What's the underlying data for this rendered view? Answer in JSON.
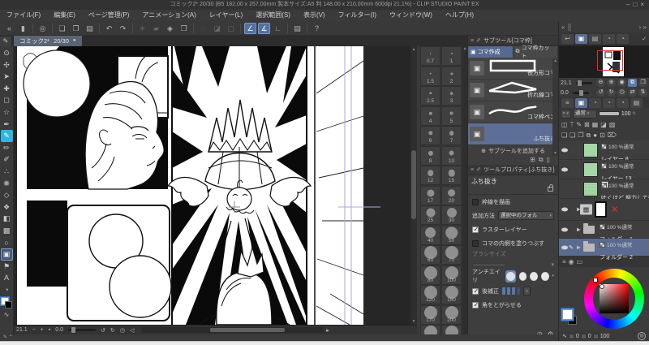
{
  "colors": {
    "accent_blue": "#5a7bb0",
    "tool_cyan": "#31b5e0",
    "selection_blue": "#5d6f96",
    "layer_green": "#a5d6a5",
    "navigator_red": "#e03030"
  },
  "title_bar": {
    "title": "コミック2* 20/30 (B5 182.00 x 257.00mm 製本サイズ:A5 判 148.00 x 210.00mm 600dpi 21.1%)  - CLIP STUDIO PAINT EX",
    "minimize": "–",
    "maximize": "□",
    "close": "×"
  },
  "menu": {
    "items": [
      "ファイル(F)",
      "編集(E)",
      "ページ管理(P)",
      "アニメーション(A)",
      "レイヤー(L)",
      "選択範囲(S)",
      "表示(V)",
      "フィルター(I)",
      "ウィンドウ(W)",
      "ヘルプ(H)"
    ]
  },
  "toolbar": {
    "buttons": [
      {
        "name": "collapse-toolbar",
        "glyph": "«",
        "state": "plain"
      },
      {
        "name": "handle",
        "glyph": "▮",
        "state": "plain"
      },
      {
        "name": "clip-studio-logo",
        "glyph": "◎",
        "state": "plain"
      },
      {
        "name": "new-file",
        "glyph": "❏",
        "state": "plain"
      },
      {
        "name": "open-file",
        "glyph": "❐",
        "state": "plain"
      },
      {
        "name": "save-file",
        "glyph": "▤",
        "state": "plain"
      },
      {
        "name": "undo",
        "glyph": "↶",
        "state": "plain"
      },
      {
        "name": "redo",
        "glyph": "↷",
        "state": "plain"
      },
      {
        "name": "clear",
        "glyph": "✳",
        "state": "dim"
      },
      {
        "name": "fill",
        "glyph": "▰",
        "state": "dim"
      },
      {
        "name": "gradient",
        "glyph": "◈",
        "state": "plain"
      },
      {
        "name": "crop",
        "glyph": "❒",
        "state": "plain"
      },
      {
        "name": "deselect",
        "glyph": "◌",
        "state": "dim"
      },
      {
        "name": "invert-selection",
        "glyph": "◪",
        "state": "dim"
      },
      {
        "name": "selection-border",
        "glyph": "▢",
        "state": "dim"
      },
      {
        "name": "snap-to-ruler",
        "glyph": "∠",
        "state": "active"
      },
      {
        "name": "snap-to-special-ruler",
        "glyph": "∡",
        "state": "active"
      },
      {
        "name": "snap-to-grid",
        "glyph": "∟",
        "state": "plain"
      },
      {
        "name": "page-manager",
        "glyph": "▤",
        "state": "plain"
      },
      {
        "name": "help",
        "glyph": "?",
        "state": "plain"
      }
    ]
  },
  "doc_tab": {
    "label": "コミック2*",
    "pages": "20/30",
    "modified_dot": "●",
    "pen_icon": "✎"
  },
  "tool_strip": {
    "tools": [
      {
        "name": "zoom-tool",
        "glyph": "⊙",
        "sel": ""
      },
      {
        "name": "hand-tool",
        "glyph": "✣",
        "sel": ""
      },
      {
        "name": "operate-tool",
        "glyph": "➤",
        "sel": ""
      },
      {
        "name": "move-layer-tool",
        "glyph": "✚",
        "sel": ""
      },
      {
        "name": "selection-tool",
        "glyph": "◻",
        "sel": ""
      },
      {
        "name": "auto-select-tool",
        "glyph": "☆",
        "sel": ""
      },
      {
        "name": "eyedropper-tool",
        "glyph": "✒",
        "sel": ""
      },
      {
        "name": "pen-tool",
        "glyph": "✎",
        "sel": "cyan"
      },
      {
        "name": "pencil-tool",
        "glyph": "✏",
        "sel": ""
      },
      {
        "name": "brush-tool",
        "glyph": "✐",
        "sel": ""
      },
      {
        "name": "airbrush-tool",
        "glyph": "∴",
        "sel": ""
      },
      {
        "name": "decoration-tool",
        "glyph": "❋",
        "sel": ""
      },
      {
        "name": "eraser-tool",
        "glyph": "◇",
        "sel": ""
      },
      {
        "name": "blend-tool",
        "glyph": "❖",
        "sel": ""
      },
      {
        "name": "fill-tool",
        "glyph": "◧",
        "sel": ""
      },
      {
        "name": "gradient-tool",
        "glyph": "▩",
        "sel": ""
      },
      {
        "name": "figure-tool",
        "glyph": "○",
        "sel": ""
      },
      {
        "name": "frame-border-tool",
        "glyph": "▣",
        "sel": "box"
      },
      {
        "name": "ruler-tool",
        "glyph": "⚑",
        "sel": ""
      },
      {
        "name": "text-tool",
        "glyph": "A",
        "sel": ""
      },
      {
        "name": "balloon-tool",
        "glyph": "◔",
        "sel": ""
      }
    ],
    "foot_glyph": "∿"
  },
  "brush_palette": {
    "rows": [
      [
        "0.7",
        "1"
      ],
      [
        "1.5",
        "2"
      ],
      [
        "2.5",
        "3"
      ],
      [
        "4",
        "5"
      ],
      [
        "6",
        "7"
      ],
      [
        "8",
        "10"
      ],
      [
        "12",
        "15"
      ],
      [
        "17",
        "20"
      ],
      [
        "25",
        "30"
      ],
      [
        "40",
        "50"
      ],
      [
        "60",
        "70"
      ],
      [
        "80",
        "100"
      ],
      [
        "120",
        "150"
      ],
      [
        "170",
        "200"
      ]
    ],
    "partial_row_visible": true
  },
  "subtool": {
    "title": "サブツール[コマ枠]",
    "tabs": [
      {
        "label": "コマ作成",
        "icon": "▣",
        "on": true
      },
      {
        "label": "コマ枠カット",
        "icon": "⧉",
        "on": false
      }
    ],
    "items": [
      {
        "label": "長方形コマ",
        "shape": "rect",
        "selected": false
      },
      {
        "label": "折れ線コマ",
        "shape": "poly",
        "selected": false
      },
      {
        "label": "コマ枠ペン",
        "shape": "curve",
        "selected": false
      },
      {
        "label": "ふち抜き",
        "shape": "none",
        "selected": true
      }
    ],
    "add_label": "サブツールを追加する",
    "add_plus": "⊕",
    "footer_icons": [
      "⊞",
      "⧉",
      "▯"
    ]
  },
  "tool_property": {
    "title": "ツールプロパティ[ふち抜き]",
    "tool_name": "ふち抜き",
    "options": [
      {
        "type": "checkbox",
        "checked": false,
        "label": "枠線を描画"
      },
      {
        "type": "dropdown",
        "label": "追加方法",
        "value": "選択中のフォル"
      },
      {
        "type": "checkbox",
        "checked": true,
        "label": "ラスターレイヤー"
      },
      {
        "type": "checkbox",
        "checked": false,
        "label": "コマの内側を塗りつぶす"
      },
      {
        "type": "slider",
        "label": "ブラシサイズ",
        "disabled": true
      },
      {
        "type": "antialias",
        "label": "アンチエイリ",
        "selected": 0,
        "count": 4
      },
      {
        "type": "stabilize",
        "checked": true,
        "label": "後補正",
        "bars_on": 3,
        "bars_total": 4
      },
      {
        "type": "checkbox",
        "checked": true,
        "label": "角をとがらせる"
      }
    ],
    "footer_icons": [
      "◷",
      "⚙"
    ]
  },
  "navigator": {
    "zoom_value": "21.1",
    "rotation_value": "0.0",
    "zoom_buttons": [
      "⊖",
      "⊕",
      "◉",
      "⧉",
      "❒"
    ],
    "rotate_buttons": [
      "↺",
      "↻",
      "◷",
      "⇄",
      "⇅"
    ]
  },
  "layer_panel": {
    "blend_mode": "通常",
    "opacity": "100",
    "layers": [
      {
        "kind": "raster",
        "name": "レイヤー 8",
        "info": "100 %通常",
        "visible": true,
        "selected": false
      },
      {
        "kind": "raster",
        "name": "レイヤー 13",
        "info": "100 %通常",
        "visible": true,
        "selected": false
      },
      {
        "kind": "text",
        "name": "吐くほど 努力しても",
        "info": "100 %通常",
        "visible": false,
        "selected": false
      },
      {
        "kind": "frame",
        "name": "",
        "info": "",
        "visible": true,
        "selected": false,
        "badge": "red-x"
      },
      {
        "kind": "folder",
        "name": "フォルダー 1",
        "info": "100 %通常",
        "visible": true,
        "selected": false
      },
      {
        "kind": "folder",
        "name": "フォルダー 2",
        "info": "100 %通常",
        "visible": true,
        "selected": true,
        "editing": true
      }
    ]
  },
  "color_panel": {
    "hue": "0",
    "saturation": "0",
    "value_v": "100",
    "wave_icon": "∿"
  },
  "canvas_bar": {
    "zoom": "21.1",
    "rotation": "0.0",
    "buttons_zoom": [
      "−",
      "+",
      "▪"
    ],
    "buttons_rotate": [
      "↺",
      "↻",
      "◷",
      "◁"
    ]
  },
  "statusbar": {
    "left_icons": "✎ ⌃"
  },
  "workspace_strip": {
    "left": "«",
    "right": "›  »"
  },
  "panel_tabs": {
    "icons": [
      "↩",
      "▣",
      "▤",
      "◔",
      "◔"
    ],
    "check": "✓"
  },
  "layer_tabs": {
    "icons": [
      "≡",
      "▣",
      "◔",
      "◔",
      "◔",
      "▤"
    ]
  },
  "lock_row": {
    "icons": [
      "◫",
      "⟙",
      "✎",
      "⊠",
      "▦",
      "◪",
      "▧"
    ]
  },
  "newlayer_row": {
    "icons": [
      "❏",
      "❏",
      "❒",
      "⧉",
      "●",
      "⊡",
      "⌦"
    ]
  },
  "color_tabs": {
    "icons": [
      "≡",
      "◉",
      "▭"
    ]
  }
}
